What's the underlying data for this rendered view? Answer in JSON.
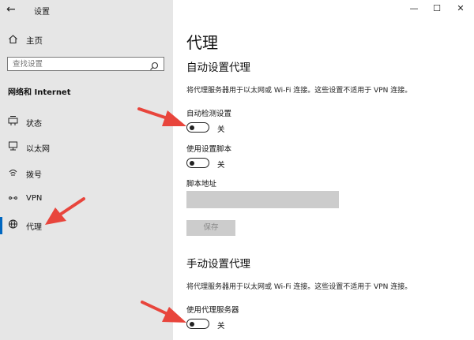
{
  "window": {
    "title": "设置",
    "back_icon": "←",
    "minimize_icon": "—",
    "maximize_icon": "☐",
    "close_icon": "✕"
  },
  "sidebar": {
    "home": {
      "icon": "home-icon",
      "label": "主页"
    },
    "search": {
      "placeholder": "查找设置",
      "icon": "search-icon"
    },
    "section_title": "网络和 Internet",
    "items": [
      {
        "icon": "status-icon",
        "label": "状态",
        "active": false
      },
      {
        "icon": "ethernet-icon",
        "label": "以太网",
        "active": false
      },
      {
        "icon": "dialup-icon",
        "label": "拨号",
        "active": false
      },
      {
        "icon": "vpn-icon",
        "label": "VPN",
        "active": false
      },
      {
        "icon": "globe-icon",
        "label": "代理",
        "active": true
      }
    ],
    "accent_color": "#0067c0"
  },
  "main": {
    "page_title": "代理",
    "auto": {
      "title": "自动设置代理",
      "description": "将代理服务器用于以太网或 Wi-Fi 连接。这些设置不适用于 VPN 连接。",
      "detect_label": "自动检测设置",
      "detect_state": "关",
      "script_label": "使用设置脚本",
      "script_state": "关",
      "address_label": "脚本地址",
      "address_value": "",
      "save_label": "保存"
    },
    "manual": {
      "title": "手动设置代理",
      "description": "将代理服务器用于以太网或 Wi-Fi 连接。这些设置不适用于 VPN 连接。",
      "use_proxy_label": "使用代理服务器",
      "use_proxy_state": "关"
    }
  },
  "annotation_color": "#e8453c"
}
